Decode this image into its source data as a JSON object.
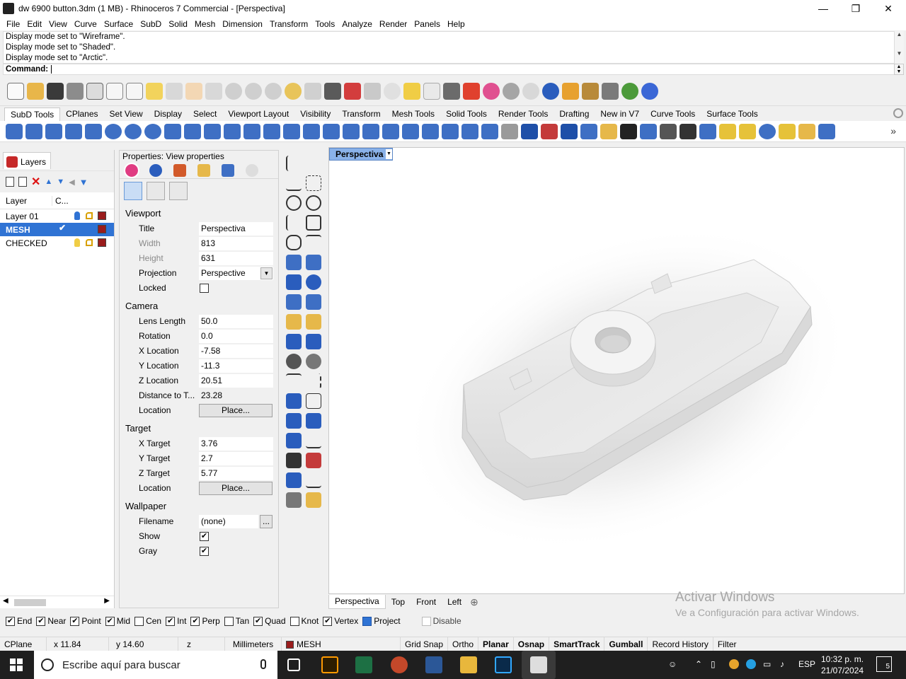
{
  "window": {
    "title": "dw 6900 button.3dm (1 MB) - Rhinoceros 7 Commercial - [Perspectiva]",
    "minimize": "—",
    "maximize": "❐",
    "close": "✕"
  },
  "menu": [
    "File",
    "Edit",
    "View",
    "Curve",
    "Surface",
    "SubD",
    "Solid",
    "Mesh",
    "Dimension",
    "Transform",
    "Tools",
    "Analyze",
    "Render",
    "Panels",
    "Help"
  ],
  "command": {
    "history": [
      "Display mode set to \"Wireframe\".",
      "Display mode set to \"Shaded\".",
      "Display mode set to \"Arctic\"."
    ],
    "prompt": "Command:"
  },
  "toolbar_tabs": [
    "SubD Tools",
    "CPlanes",
    "Set View",
    "Display",
    "Select",
    "Viewport Layout",
    "Visibility",
    "Transform",
    "Mesh Tools",
    "Solid Tools",
    "Render Tools",
    "Drafting",
    "New in V7",
    "Curve Tools",
    "Surface Tools"
  ],
  "layers": {
    "tab_label": "Layers",
    "col_layer": "Layer",
    "col_current": "C...",
    "rows": [
      {
        "name": "Layer 01",
        "current": "",
        "color": "#9a1c1c"
      },
      {
        "name": "MESH",
        "current": "✔",
        "color": "#9a1c1c"
      },
      {
        "name": "CHECKED",
        "current": "",
        "color": "#9a1c1c"
      }
    ]
  },
  "properties": {
    "title": "Properties: View properties",
    "sections": {
      "viewport": "Viewport",
      "camera": "Camera",
      "target": "Target",
      "wallpaper": "Wallpaper"
    },
    "viewport": {
      "title_label": "Title",
      "title_value": "Perspectiva",
      "width_label": "Width",
      "width_value": "813",
      "height_label": "Height",
      "height_value": "631",
      "projection_label": "Projection",
      "projection_value": "Perspective",
      "locked_label": "Locked",
      "locked_value": ""
    },
    "camera": {
      "lens_label": "Lens Length",
      "lens_value": "50.0",
      "rotation_label": "Rotation",
      "rotation_value": "0.0",
      "x_label": "X Location",
      "x_value": "-7.58",
      "y_label": "Y Location",
      "y_value": "-11.3",
      "z_label": "Z Location",
      "z_value": "20.51",
      "dist_label": "Distance to T...",
      "dist_value": "23.28",
      "loc_label": "Location",
      "loc_button": "Place..."
    },
    "target": {
      "x_label": "X Target",
      "x_value": "3.76",
      "y_label": "Y Target",
      "y_value": "2.7",
      "z_label": "Z Target",
      "z_value": "5.77",
      "loc_label": "Location",
      "loc_button": "Place..."
    },
    "wallpaper": {
      "file_label": "Filename",
      "file_value": "(none)",
      "file_button": "...",
      "show_label": "Show",
      "show_value": "✔",
      "gray_label": "Gray",
      "gray_value": "✔"
    }
  },
  "viewport": {
    "title": "Perspectiva",
    "tabs": [
      "Perspectiva",
      "Top",
      "Front",
      "Left"
    ],
    "add_tab": "⊕"
  },
  "osnap": [
    {
      "label": "End",
      "checked": "✔"
    },
    {
      "label": "Near",
      "checked": "✔"
    },
    {
      "label": "Point",
      "checked": "✔"
    },
    {
      "label": "Mid",
      "checked": "✔"
    },
    {
      "label": "Cen",
      "checked": ""
    },
    {
      "label": "Int",
      "checked": "✔"
    },
    {
      "label": "Perp",
      "checked": "✔"
    },
    {
      "label": "Tan",
      "checked": ""
    },
    {
      "label": "Quad",
      "checked": "✔"
    },
    {
      "label": "Knot",
      "checked": ""
    },
    {
      "label": "Vertex",
      "checked": "✔"
    },
    {
      "label": "Project",
      "checked": ""
    },
    {
      "label": "Disable",
      "checked": ""
    }
  ],
  "status": {
    "cplane": "CPlane",
    "x": "x 11.84",
    "y": "y 14.60",
    "z": "z",
    "units": "Millimeters",
    "layer": "MESH",
    "grid_snap": "Grid Snap",
    "ortho": "Ortho",
    "planar": "Planar",
    "osnap": "Osnap",
    "smarttrack": "SmartTrack",
    "gumball": "Gumball",
    "record_history": "Record History",
    "filter": "Filter"
  },
  "watermark": {
    "line1": "Activar Windows",
    "line2": "Ve a Configuración para activar Windows."
  },
  "taskbar": {
    "search_placeholder": "Escribe aquí para buscar",
    "language": "ESP",
    "time": "10:32 p. m.",
    "date": "21/07/2024",
    "notifications": "5"
  }
}
